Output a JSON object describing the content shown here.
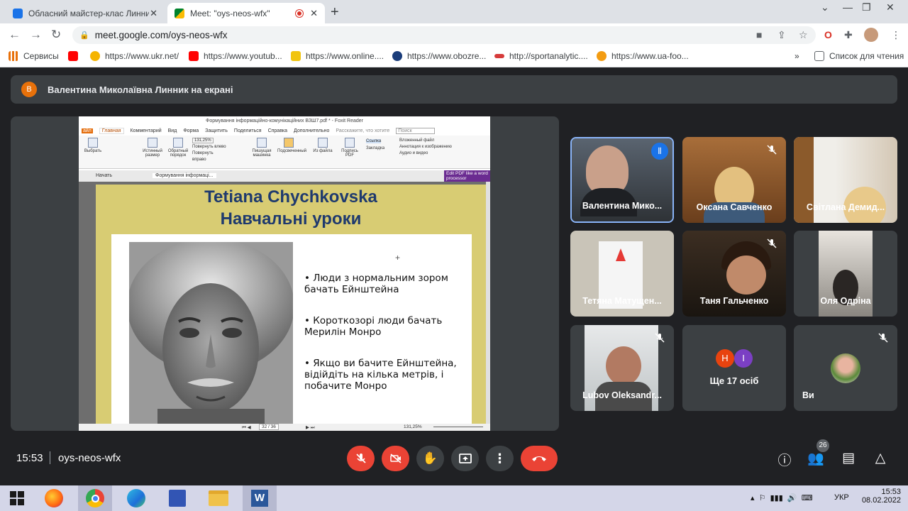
{
  "browser": {
    "tabs": [
      {
        "title": "Обласний майстер-клас Линник",
        "active": false
      },
      {
        "title": "Meet: \"oys-neos-wfx\"",
        "active": true
      }
    ],
    "url": "meet.google.com/oys-neos-wfx",
    "bookmarks": [
      {
        "label": "Сервисы",
        "icon": "apps-icon",
        "color": "#e8710a"
      },
      {
        "label": "",
        "icon": "youtube-icon",
        "color": "#ff0000"
      },
      {
        "label": "https://www.ukr.net/",
        "icon": "ukrnet-icon",
        "color": "#f5b400"
      },
      {
        "label": "https://www.youtub...",
        "icon": "youtube-icon",
        "color": "#ff0000"
      },
      {
        "label": "https://www.online....",
        "icon": "ua-icon",
        "color": "#f1c40f"
      },
      {
        "label": "https://www.obozre...",
        "icon": "obozrevatel-icon",
        "color": "#1a3c7a"
      },
      {
        "label": "http://sportanalytic....",
        "icon": "sport-icon",
        "color": "#d63b3b"
      },
      {
        "label": "https://www.ua-foo...",
        "icon": "uafootball-icon",
        "color": "#f39c12"
      }
    ],
    "bookmarks_more": "»",
    "reading_list": "Список для чтения"
  },
  "meet": {
    "banner": {
      "avatar_letter": "В",
      "text": "Валентина Миколаївна Линник на екрані"
    },
    "shared": {
      "window_title": "Формування інформаційно-комунікаційних  ВЗШ7.pdf * - Foxit Reader",
      "menu": [
        "айл",
        "Главная",
        "Комментарий",
        "Вид",
        "Форма",
        "Защитить",
        "Поделиться",
        "Справка",
        "Дополнительно"
      ],
      "search_hint": "Расскажите, что хотите",
      "search_box": "Поиск",
      "ribbon": [
        "Выбрать",
        "Истинный размер",
        "Обратный порядок",
        "131,25%",
        "Повернуть влево",
        "Повернуть вправо",
        "Пишущая машинка",
        "Подсвеченный",
        "Из файла",
        "Подпись PDF",
        "Ссылка",
        "Закладка",
        "Вложенный файл",
        "Аннотация к изображению",
        "Аудио и видео"
      ],
      "doc_tabs": [
        "Начать",
        "Формування інформаці..."
      ],
      "ad": "Edit PDF like a word processor",
      "slide_title_1": "Tetiana Chychkovska",
      "slide_title_2": "Навчальні уроки",
      "bullets": [
        "Люди з нормальним зором бачать Ейнштейна",
        "Короткозорі люди бачать Мерилін Монро",
        "Якщо ви бачите Ейнштейна, відійдіть на кілька метрів, і побачите Монро"
      ],
      "page_indicator": "32 / 36",
      "zoom": "131,25%"
    },
    "participants": [
      {
        "name": "Валентина Мико...",
        "muted": false,
        "speaking": true
      },
      {
        "name": "Оксана Савченко",
        "muted": true
      },
      {
        "name": "Світлана Демид...",
        "muted": false
      },
      {
        "name": "Тетяна Матущен...",
        "muted": false
      },
      {
        "name": "Таня Гальченко",
        "muted": true
      },
      {
        "name": "Оля Одріна",
        "muted": false
      },
      {
        "name": "Lubov Oleksandr...",
        "muted": true
      },
      {
        "name": "Ще 17 осіб",
        "muted": false,
        "avatars": [
          "Н",
          "І"
        ]
      },
      {
        "name": "Ви",
        "muted": true
      }
    ],
    "time": "15:53",
    "meeting_code": "oys-neos-wfx",
    "people_count": "26"
  },
  "taskbar": {
    "lang": "УКР",
    "time": "15:53",
    "date": "08.02.2022"
  }
}
